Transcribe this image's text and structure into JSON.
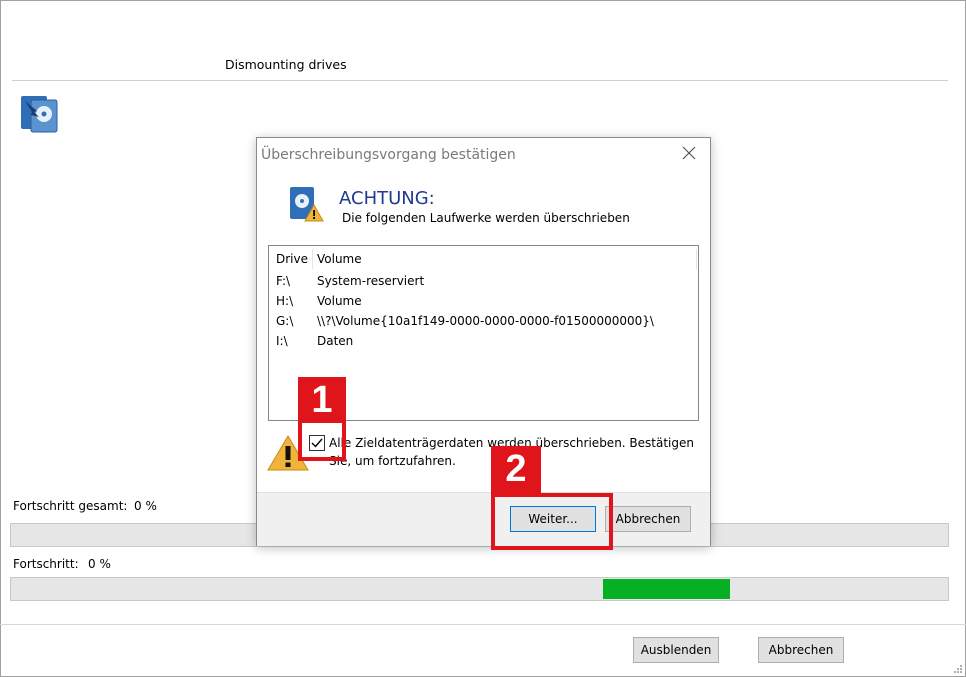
{
  "main": {
    "section_title": "Dismounting drives",
    "icon": "drive-dismount-icon",
    "progress_total": {
      "label": "Fortschritt gesamt:",
      "value": "0 %",
      "fill": 0.0
    },
    "progress_current": {
      "label": "Fortschritt:",
      "value": "0 %",
      "marquee": true
    }
  },
  "footer": {
    "hide_label": "Ausblenden",
    "cancel_label": "Abbrechen"
  },
  "dialog": {
    "title": "Überschreibungsvorgang bestätigen",
    "icon": "disk-warning-icon",
    "heading": "ACHTUNG:",
    "subheading": "Die folgenden Laufwerke werden überschrieben",
    "columns": [
      "Drive",
      "Volume"
    ],
    "rows": [
      {
        "drive": "F:\\",
        "volume": "System-reserviert"
      },
      {
        "drive": "H:\\",
        "volume": "Volume"
      },
      {
        "drive": "G:\\",
        "volume": "\\\\?\\Volume{10a1f149-0000-0000-0000-f01500000000}\\"
      },
      {
        "drive": "I:\\",
        "volume": "Daten"
      }
    ],
    "confirm_text": "Alle Zieldatenträgerdaten werden überschrieben. Bestätigen Sie, um fortzufahren.",
    "confirm_checked": true,
    "next_label": "Weiter...",
    "cancel_label": "Abbrechen"
  },
  "annotations": {
    "marker_1": "1",
    "marker_2": "2",
    "color": "#e0141b"
  },
  "colors": {
    "progress_green": "#06b025",
    "heading_blue": "#1f3a8f"
  }
}
